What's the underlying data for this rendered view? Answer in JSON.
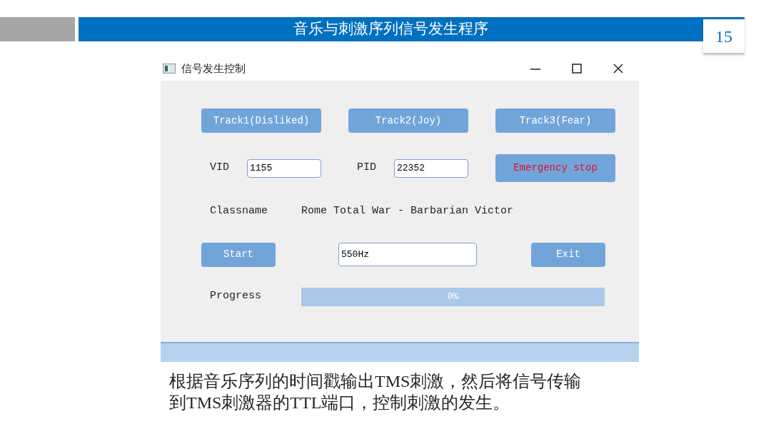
{
  "slide": {
    "title": "音乐与刺激序列信号发生程序",
    "page_number": "15"
  },
  "window": {
    "title": "信号发生控制"
  },
  "track_buttons": [
    "Track1(Disliked)",
    "Track2(Joy)",
    "Track3(Fear)"
  ],
  "vid": {
    "label": "VID",
    "value": "1155"
  },
  "pid": {
    "label": "PID",
    "value": "22352"
  },
  "emergency_button": "Emergency stop",
  "classname": {
    "label": "Classname",
    "value": "Rome Total War - Barbarian Victor"
  },
  "start_button": "Start",
  "frequency": {
    "value": "550Hz"
  },
  "exit_button": "Exit",
  "progress": {
    "label": "Progress",
    "level": 0,
    "reading": "0%"
  },
  "caption": "根据音乐序列的时间戳输出TMS刺激，然后将信号传输到TMS刺激器的TTL端口，控制刺激的发生。"
}
